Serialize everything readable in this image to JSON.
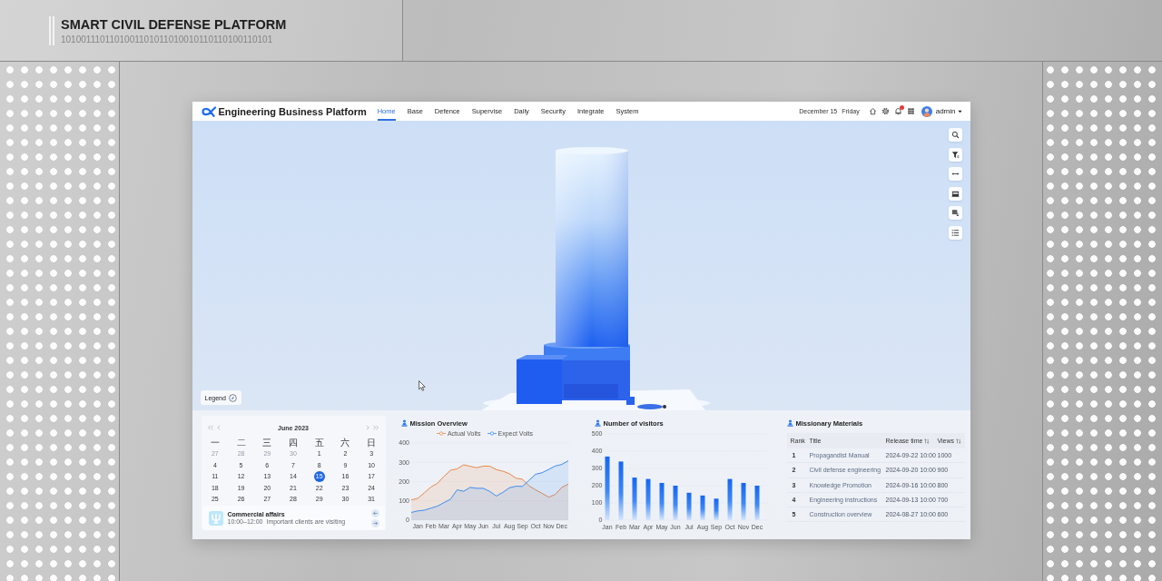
{
  "header": {
    "title": "SMART CIVIL DEFENSE PLATFORM",
    "code": "1010011101101001101011010010110110100110101"
  },
  "app": {
    "title": "Engineering Business Platform",
    "nav": [
      {
        "label": "Home",
        "selected": true
      },
      {
        "label": "Base",
        "selected": false
      },
      {
        "label": "Defence",
        "selected": false
      },
      {
        "label": "Supervise",
        "selected": false
      },
      {
        "label": "Daily",
        "selected": false
      },
      {
        "label": "Security",
        "selected": false
      },
      {
        "label": "Integrate",
        "selected": false
      },
      {
        "label": "System",
        "selected": false
      }
    ],
    "date": "December 15",
    "weekday": "Friday",
    "notifications_unread": true,
    "user": "admin"
  },
  "viewport": {
    "legend_button": "Legend"
  },
  "calendar": {
    "month": "June 2023",
    "weekdays": [
      "一",
      "二",
      "三",
      "四",
      "五",
      "六",
      "日"
    ],
    "days": [
      {
        "label": "27",
        "outside": true,
        "selected": false
      },
      {
        "label": "28",
        "outside": true,
        "selected": false
      },
      {
        "label": "29",
        "outside": true,
        "selected": false
      },
      {
        "label": "30",
        "outside": true,
        "selected": false
      },
      {
        "label": "1",
        "outside": false,
        "selected": false
      },
      {
        "label": "2",
        "outside": false,
        "selected": false
      },
      {
        "label": "3",
        "outside": false,
        "selected": false
      },
      {
        "label": "4",
        "outside": false,
        "selected": false
      },
      {
        "label": "5",
        "outside": false,
        "selected": false
      },
      {
        "label": "6",
        "outside": false,
        "selected": false
      },
      {
        "label": "7",
        "outside": false,
        "selected": false
      },
      {
        "label": "8",
        "outside": false,
        "selected": false
      },
      {
        "label": "9",
        "outside": false,
        "selected": false
      },
      {
        "label": "10",
        "outside": false,
        "selected": false
      },
      {
        "label": "11",
        "outside": false,
        "selected": false
      },
      {
        "label": "12",
        "outside": false,
        "selected": false
      },
      {
        "label": "13",
        "outside": false,
        "selected": false
      },
      {
        "label": "14",
        "outside": false,
        "selected": false
      },
      {
        "label": "15",
        "outside": false,
        "selected": true
      },
      {
        "label": "16",
        "outside": false,
        "selected": false
      },
      {
        "label": "17",
        "outside": false,
        "selected": false
      },
      {
        "label": "18",
        "outside": false,
        "selected": false
      },
      {
        "label": "19",
        "outside": false,
        "selected": false
      },
      {
        "label": "20",
        "outside": false,
        "selected": false
      },
      {
        "label": "21",
        "outside": false,
        "selected": false
      },
      {
        "label": "22",
        "outside": false,
        "selected": false
      },
      {
        "label": "23",
        "outside": false,
        "selected": false
      },
      {
        "label": "24",
        "outside": false,
        "selected": false
      },
      {
        "label": "25",
        "outside": false,
        "selected": false
      },
      {
        "label": "26",
        "outside": false,
        "selected": false
      },
      {
        "label": "27",
        "outside": false,
        "selected": false
      },
      {
        "label": "28",
        "outside": false,
        "selected": false
      },
      {
        "label": "29",
        "outside": false,
        "selected": false
      },
      {
        "label": "30",
        "outside": false,
        "selected": false
      },
      {
        "label": "31",
        "outside": false,
        "selected": false
      }
    ],
    "event": {
      "title": "Commercial affairs",
      "time": "10:00–12:00",
      "description": "Important clients are visiting"
    }
  },
  "mission_overview": {
    "title": "Mission Overview",
    "chart_data": {
      "type": "area",
      "categories": [
        null,
        "Jan",
        null,
        "Feb",
        null,
        "Mar",
        null,
        "Apr",
        null,
        "May",
        null,
        "Jun",
        null,
        "Jul",
        null,
        "Aug",
        null,
        "Sep",
        null,
        "Oct",
        null,
        "Nov",
        null,
        "Dec",
        null
      ],
      "series": [
        {
          "name": "Actual Volts",
          "color": "#e8894a",
          "values": [
            105,
            113,
            142,
            172,
            191,
            227,
            259,
            266,
            287,
            279,
            272,
            280,
            280,
            262,
            254,
            241,
            218,
            212,
            178,
            157,
            139,
            119,
            133,
            170,
            187
          ]
        },
        {
          "name": "Expect Volts",
          "color": "#3d8ef0",
          "values": [
            40,
            48,
            52,
            62,
            73,
            91,
            109,
            157,
            150,
            170,
            165,
            165,
            149,
            125,
            144,
            168,
            176,
            175,
            207,
            238,
            246,
            263,
            281,
            289,
            308
          ]
        }
      ],
      "ylim": [
        0,
        400
      ],
      "yticks": [
        0,
        100,
        200,
        300,
        400
      ]
    }
  },
  "visitors": {
    "title": "Number of visitors",
    "chart_data": {
      "type": "bar",
      "categories": [
        "Jan",
        "Feb",
        "Mar",
        "Apr",
        "May",
        "Jun",
        "Jul",
        "Aug",
        "Sep",
        "Oct",
        "Nov",
        "Dec"
      ],
      "values": [
        369,
        340,
        247,
        239,
        216,
        200,
        159,
        143,
        125,
        239,
        216,
        200
      ],
      "ylim": [
        0,
        500
      ],
      "yticks": [
        0,
        100,
        200,
        300,
        400,
        500
      ]
    }
  },
  "materials": {
    "title": "Missionary Materials",
    "columns": [
      {
        "label": "Rank",
        "sortable": false
      },
      {
        "label": "Title",
        "sortable": false
      },
      {
        "label": "Release time",
        "sortable": true
      },
      {
        "label": "Views",
        "sortable": true
      }
    ],
    "rows": [
      {
        "rank": "1",
        "title": "Propagandist Manual",
        "release_time": "2024-09-22 10:00",
        "views": "1000"
      },
      {
        "rank": "2",
        "title": "Civil defense engineering",
        "release_time": "2024-09-20 10:00",
        "views": "900"
      },
      {
        "rank": "3",
        "title": "Knowledge Promotion",
        "release_time": "2024-09-16 10:00",
        "views": "800"
      },
      {
        "rank": "4",
        "title": "Engineering instructions",
        "release_time": "2024-09-13 10:00",
        "views": "700"
      },
      {
        "rank": "5",
        "title": "Construction overview",
        "release_time": "2024-08-27 10:00",
        "views": "600"
      }
    ]
  }
}
